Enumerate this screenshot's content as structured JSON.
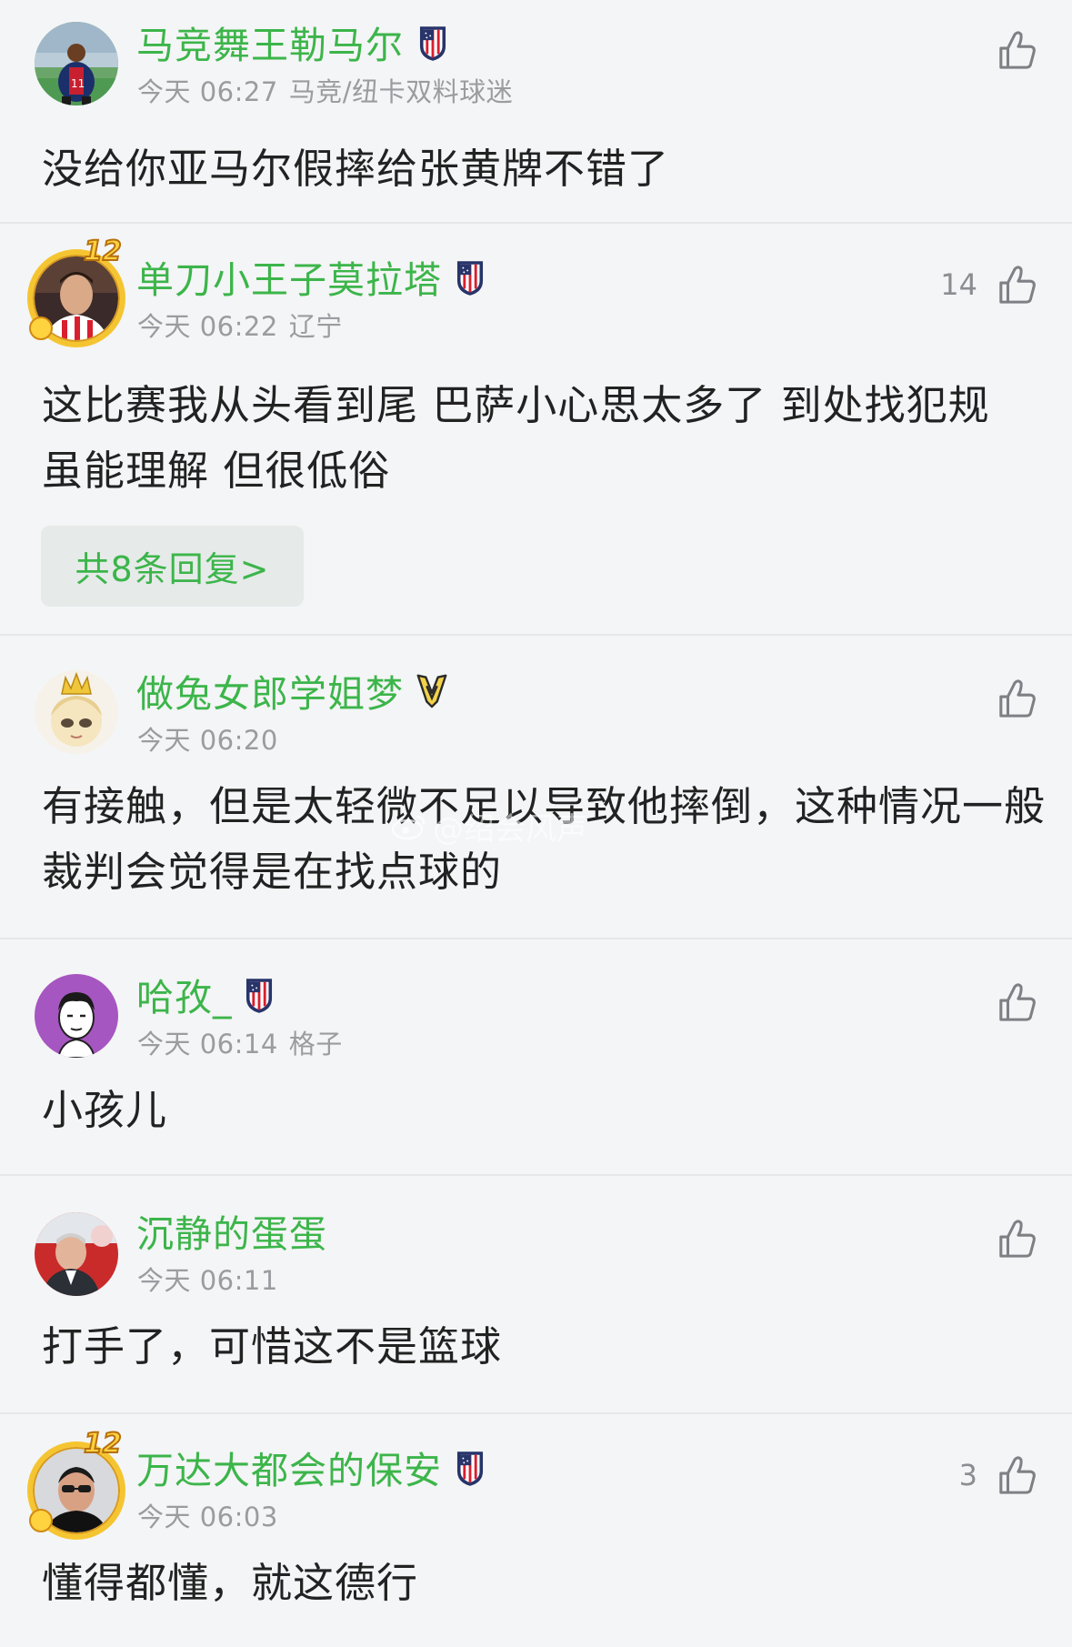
{
  "comments": [
    {
      "username": "马竞舞王勒马尔",
      "time": "今天 06:27",
      "location": "马竞/纽卡双料球迷",
      "content": "没给你亚马尔假摔给张黄牌不错了",
      "likes": "",
      "team_badge": "atletico-madrid-crest",
      "avatar": "football-player-avatar"
    },
    {
      "username": "单刀小王子莫拉塔",
      "time": "今天 06:22",
      "location": "辽宁",
      "content": "这比赛我从头看到尾 巴萨小心思太多了 到处找犯规 虽能理解 但很低俗",
      "likes": "14",
      "reply_button": "共8条回复>",
      "level": "12",
      "team_badge": "atletico-madrid-crest",
      "avatar": "morata-avatar"
    },
    {
      "username": "做兔女郎学姐梦",
      "time": "今天 06:20",
      "location": "",
      "content": "有接触，但是太轻微不足以导致他摔倒，这种情况一般裁判会觉得是在找点球的",
      "likes": "",
      "team_badge": "vitality-wasp-logo",
      "avatar": "anime-girl-crown-avatar"
    },
    {
      "username": "哈孜_",
      "time": "今天 06:14",
      "location": "格子",
      "content": "小孩儿",
      "likes": "",
      "team_badge": "atletico-madrid-crest",
      "avatar": "cartoon-man-avatar"
    },
    {
      "username": "沉静的蛋蛋",
      "time": "今天 06:11",
      "location": "",
      "content": "打手了，可惜这不是篮球",
      "likes": "",
      "avatar": "man-stadium-avatar"
    },
    {
      "username": "万达大都会的保安",
      "time": "今天 06:03",
      "location": "",
      "content": "懂得都懂，就这德行",
      "likes": "3",
      "level": "12",
      "team_badge": "atletico-madrid-crest",
      "avatar": "man-sunglasses-avatar"
    }
  ],
  "watermark": "@绍会风声",
  "colors": {
    "username": "#3cb54a",
    "meta": "#9a9ca0",
    "body": "#222222",
    "background": "#f4f5f6",
    "divider": "#e6e7e9",
    "reply_bg": "#e6eae9"
  }
}
